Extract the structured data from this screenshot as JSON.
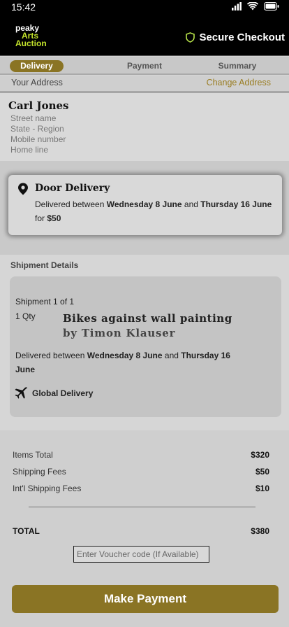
{
  "status": {
    "time": "15:42"
  },
  "header": {
    "logo": {
      "line1": "peaky",
      "line2": "Arts",
      "line3": "Auction"
    },
    "secure_label": "Secure Checkout"
  },
  "steps": [
    {
      "label": "Delivery",
      "active": true
    },
    {
      "label": "Payment",
      "active": false
    },
    {
      "label": "Summary",
      "active": false
    }
  ],
  "address": {
    "heading": "Your Address",
    "change_link": "Change Address",
    "name": "Carl Jones",
    "lines": [
      "Street name",
      "State - Region",
      "Mobile number",
      "Home line"
    ]
  },
  "delivery": {
    "title": "Door Delivery",
    "text_prefix": "Delivered between ",
    "date_from": "Wednesday 8 June",
    "and": " and ",
    "date_to": "Thursday 16 June",
    "for": " for ",
    "price": "$50"
  },
  "shipment": {
    "heading": "Shipment Details",
    "count": "Shipment 1 of 1",
    "qty": "1 Qty",
    "item_title": "Bikes against wall painting",
    "item_artist": "by Timon Klauser",
    "del_prefix": "Delivered between ",
    "date_from": "Wednesday 8 June",
    "and": " and ",
    "date_to": "Thursday 16 June",
    "global_label": "Global Delivery"
  },
  "totals": {
    "items_label": "Items Total",
    "items_value": "$320",
    "shipping_label": "Shipping Fees",
    "shipping_value": "$50",
    "intl_label": "Int'l Shipping Fees",
    "intl_value": "$10",
    "total_label": "TOTAL",
    "total_value": "$380",
    "voucher_placeholder": "Enter Voucher code (If Available)",
    "pay_button": "Make Payment"
  },
  "colors": {
    "accent": "#8a7424",
    "brand_green": "#c3e32b",
    "secure_green": "#b8e34a"
  }
}
